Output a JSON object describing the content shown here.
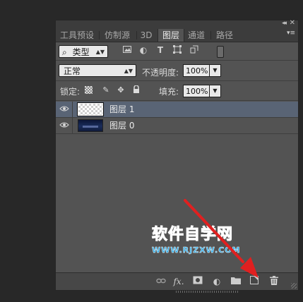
{
  "panel": {
    "collapse_glyph": "◂◂",
    "close_glyph": "✕",
    "menu_glyph": "▾≡",
    "tabs": [
      {
        "label": "工具预设",
        "active": false
      },
      {
        "label": "仿制源",
        "active": false
      },
      {
        "label": "3D",
        "active": false
      },
      {
        "label": "图层",
        "active": true
      },
      {
        "label": "通道",
        "active": false
      },
      {
        "label": "路径",
        "active": false
      }
    ]
  },
  "filter": {
    "search_glyph": "⌕",
    "kind_label": "类型",
    "icons": [
      "image-filter-icon",
      "adjustment-filter-icon",
      "type-filter-icon",
      "shape-filter-icon",
      "smart-object-filter-icon"
    ],
    "toggle_icon": "filter-toggle-icon"
  },
  "blend": {
    "mode": "正常",
    "opacity_label": "不透明度:",
    "opacity_value": "100%"
  },
  "lock": {
    "label": "锁定:",
    "icons": [
      "lock-transparent-pixels-icon",
      "lock-image-pixels-icon",
      "lock-position-icon",
      "lock-all-icon"
    ],
    "fill_label": "填充:",
    "fill_value": "100%"
  },
  "layers": [
    {
      "name": "图层 1",
      "selected": true,
      "visible": true,
      "thumbnail": "transparent-checker"
    },
    {
      "name": "图层 0",
      "selected": false,
      "visible": true,
      "thumbnail": "night-sky-image"
    }
  ],
  "bottom_icons": [
    "link-layers-icon",
    "fx-icon",
    "add-mask-icon",
    "adjustment-layer-icon",
    "group-folder-icon",
    "new-layer-icon",
    "trash-icon"
  ],
  "bottom_glyphs": {
    "link": "⛓",
    "fx": "fx.",
    "mask": "◙",
    "adjust": "◐",
    "folder": "▬",
    "new": "▣",
    "trash": "🗑"
  },
  "watermark": {
    "title": "软件自学网",
    "url": "WWW.RJZXW.COM"
  },
  "colors": {
    "selected_layer": "#596475",
    "panel_bg": "#535353",
    "annotation_arrow": "#e02020",
    "watermark": "#27a9e8"
  }
}
